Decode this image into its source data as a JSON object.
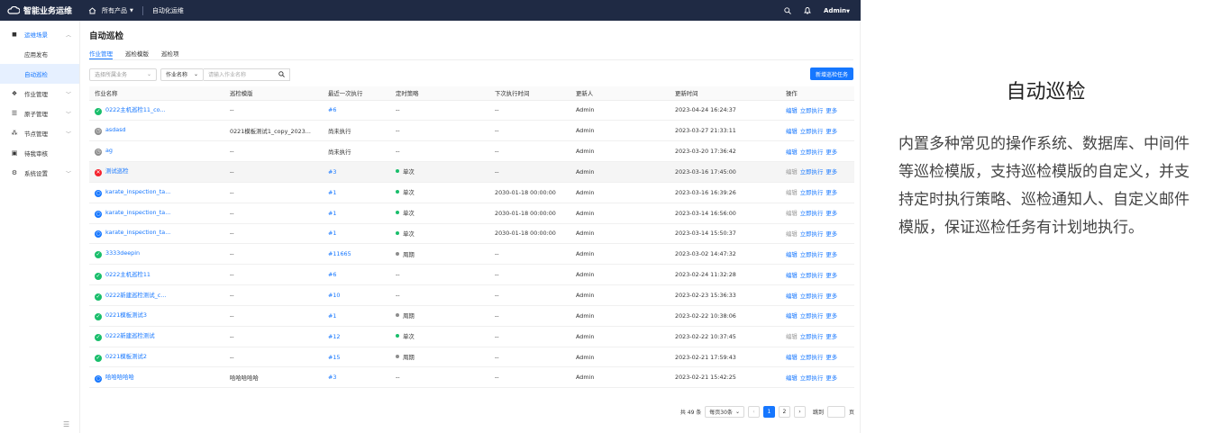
{
  "topbar": {
    "app_name": "智能业务运维",
    "all_products": "所有产品",
    "section": "自动化运维",
    "user": "Admin"
  },
  "sidebar": {
    "items": [
      {
        "label": "运维场景",
        "icon": "cube-icon"
      },
      {
        "label": "应用发布"
      },
      {
        "label": "自动巡检"
      },
      {
        "label": "作业管理",
        "icon": "jobs-icon"
      },
      {
        "label": "原子管理",
        "icon": "atom-icon"
      },
      {
        "label": "节点管理",
        "icon": "nodes-icon"
      },
      {
        "label": "待我审核",
        "icon": "review-icon"
      },
      {
        "label": "系统设置",
        "icon": "gear-icon"
      }
    ]
  },
  "main": {
    "title": "自动巡检",
    "tabs": [
      "作业管理",
      "巡检模版",
      "巡检项"
    ],
    "filter_business_placeholder": "选择所属业务",
    "filter_field": "作业名称",
    "search_placeholder": "请输入作业名称",
    "new_button": "新增巡检任务",
    "columns": [
      "作业名称",
      "巡检模版",
      "最近一次执行",
      "定时策略",
      "下次执行时间",
      "更新人",
      "更新时间",
      "操作"
    ],
    "actions": {
      "edit": "编辑",
      "run": "立即执行",
      "more": "更多"
    },
    "rows": [
      {
        "status": "success",
        "name": "0222主机巡检11_co...",
        "template": "--",
        "last": "#6",
        "last_link": true,
        "policy": "--",
        "policy_dot": "",
        "next": "--",
        "updater": "Admin",
        "updated": "2023-04-24 16:24:37",
        "disabled": false,
        "hl": false
      },
      {
        "status": "pending",
        "name": "asdasd",
        "template": "0221模板测试1_copy_2023...",
        "last": "尚未执行",
        "last_link": false,
        "policy": "--",
        "policy_dot": "",
        "next": "--",
        "updater": "Admin",
        "updated": "2023-03-27 21:33:11",
        "disabled": false,
        "hl": false
      },
      {
        "status": "pending",
        "name": "ag",
        "template": "--",
        "last": "尚未执行",
        "last_link": false,
        "policy": "--",
        "policy_dot": "",
        "next": "--",
        "updater": "Admin",
        "updated": "2023-03-20 17:36:42",
        "disabled": false,
        "hl": false
      },
      {
        "status": "failed",
        "name": "测试巡检",
        "template": "--",
        "last": "#3",
        "last_link": true,
        "policy": "单次",
        "policy_dot": "g",
        "next": "--",
        "updater": "Admin",
        "updated": "2023-03-16 17:45:00",
        "disabled": true,
        "hl": true
      },
      {
        "status": "running",
        "name": "karate_inspection_ta...",
        "template": "--",
        "last": "#1",
        "last_link": true,
        "policy": "单次",
        "policy_dot": "g",
        "next": "2030-01-18 00:00:00",
        "updater": "Admin",
        "updated": "2023-03-16 16:39:26",
        "disabled": true,
        "hl": false
      },
      {
        "status": "running",
        "name": "karate_inspection_ta...",
        "template": "--",
        "last": "#1",
        "last_link": true,
        "policy": "单次",
        "policy_dot": "g",
        "next": "2030-01-18 00:00:00",
        "updater": "Admin",
        "updated": "2023-03-14 16:56:00",
        "disabled": true,
        "hl": false
      },
      {
        "status": "running",
        "name": "karate_inspection_ta...",
        "template": "--",
        "last": "#1",
        "last_link": true,
        "policy": "单次",
        "policy_dot": "g",
        "next": "2030-01-18 00:00:00",
        "updater": "Admin",
        "updated": "2023-03-14 15:50:37",
        "disabled": true,
        "hl": false
      },
      {
        "status": "success",
        "name": "3333deepin",
        "template": "--",
        "last": "#11665",
        "last_link": true,
        "policy": "周期",
        "policy_dot": "k",
        "next": "--",
        "updater": "Admin",
        "updated": "2023-03-02 14:47:32",
        "disabled": false,
        "hl": false
      },
      {
        "status": "success",
        "name": "0222主机巡检11",
        "template": "--",
        "last": "#6",
        "last_link": true,
        "policy": "--",
        "policy_dot": "",
        "next": "--",
        "updater": "Admin",
        "updated": "2023-02-24 11:32:28",
        "disabled": false,
        "hl": false
      },
      {
        "status": "success",
        "name": "0222新建巡检测试_c...",
        "template": "--",
        "last": "#10",
        "last_link": true,
        "policy": "--",
        "policy_dot": "",
        "next": "--",
        "updater": "Admin",
        "updated": "2023-02-23 15:36:33",
        "disabled": false,
        "hl": false
      },
      {
        "status": "success",
        "name": "0221模板测试3",
        "template": "--",
        "last": "#1",
        "last_link": true,
        "policy": "周期",
        "policy_dot": "k",
        "next": "--",
        "updater": "Admin",
        "updated": "2023-02-22 10:38:06",
        "disabled": false,
        "hl": false
      },
      {
        "status": "success",
        "name": "0222新建巡检测试",
        "template": "--",
        "last": "#12",
        "last_link": true,
        "policy": "单次",
        "policy_dot": "g",
        "next": "--",
        "updater": "Admin",
        "updated": "2023-02-22 10:37:45",
        "disabled": true,
        "hl": false
      },
      {
        "status": "success",
        "name": "0221模板测试2",
        "template": "--",
        "last": "#15",
        "last_link": true,
        "policy": "周期",
        "policy_dot": "k",
        "next": "--",
        "updater": "Admin",
        "updated": "2023-02-21 17:59:43",
        "disabled": false,
        "hl": false
      },
      {
        "status": "running",
        "name": "哈哈哈哈哈",
        "template": "哈哈哈哈哈",
        "last": "#3",
        "last_link": true,
        "policy": "--",
        "policy_dot": "",
        "next": "--",
        "updater": "Admin",
        "updated": "2023-02-21 15:42:25",
        "disabled": false,
        "hl": false
      }
    ]
  },
  "pager": {
    "total": "共 49 条",
    "page_size": "每页30条",
    "pages": [
      "1",
      "2"
    ],
    "current": "1",
    "jump_label": "跳到",
    "page_unit": "页"
  },
  "panel": {
    "title": "自动巡检",
    "text": "内置多种常见的操作系统、数据库、中间件等巡检模版，支持巡检模版的自定义，并支持定时执行策略、巡检通知人、自定义邮件模版，保证巡检任务有计划地执行。"
  },
  "colors": {
    "topbar": "#1f2a44",
    "accent": "#1677ff",
    "success": "#19be6b",
    "failed": "#f5222d",
    "pending": "#8c8c8c"
  }
}
